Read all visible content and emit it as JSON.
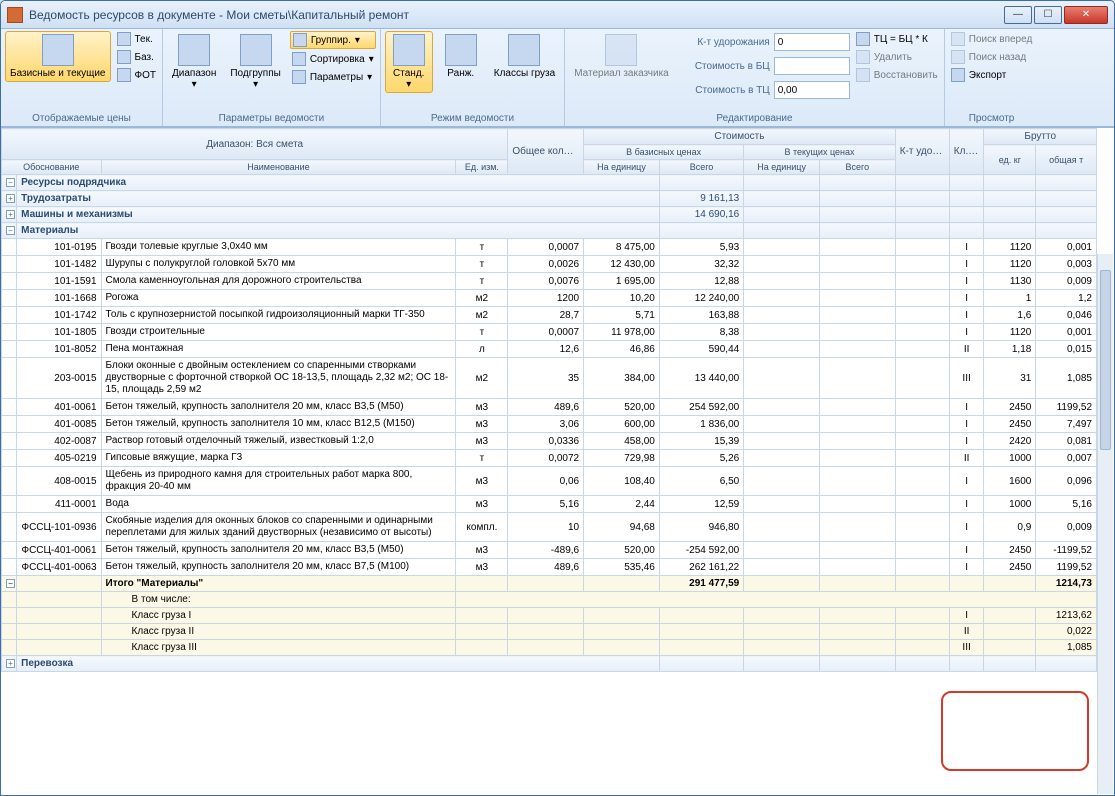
{
  "window": {
    "title": "Ведомость ресурсов в документе - Мои сметы\\Капитальный ремонт"
  },
  "ribbon": {
    "g1": {
      "big": "Базисные и текущие",
      "items": [
        "Тек.",
        "Баз.",
        "ФОТ"
      ],
      "label": "Отображаемые цены"
    },
    "g2": {
      "b1": "Диапазон",
      "b2": "Подгруппы",
      "items": [
        "Группир.",
        "Сортировка",
        "Параметры"
      ],
      "label": "Параметры ведомости"
    },
    "g3": {
      "b1": "Станд.",
      "b2": "Ранж.",
      "b3": "Классы груза",
      "label": "Режим ведомости"
    },
    "g4": {
      "b1": "Материал заказчика",
      "rows": [
        {
          "lbl": "К-т удорожания",
          "val": "0"
        },
        {
          "lbl": "Стоимость в БЦ",
          "val": ""
        },
        {
          "lbl": "Стоимость в ТЦ",
          "val": "0,00"
        }
      ],
      "items": [
        "ТЦ = БЦ * К",
        "Удалить",
        "Восстановить"
      ],
      "label": "Редактирование"
    },
    "g5": {
      "items": [
        "Поиск вперед",
        "Поиск назад",
        "Экспорт"
      ],
      "label": "Просмотр"
    }
  },
  "headers": {
    "range": "Диапазон: Вся смета",
    "cols": {
      "obos": "Обоснование",
      "name": "Наименование",
      "ed": "Ед. изм.",
      "qty": "Общее количество",
      "cost": "Стоимость",
      "base": "В базисных ценах",
      "cur": "В текущих ценах",
      "perunit": "На единицу",
      "total": "Всего",
      "kudor": "К-т удор. ТЦ=БЦ*К",
      "klgr": "Кл. гру-за",
      "brutto": "Брутто",
      "edkg": "ед. кг",
      "obt": "общая т"
    }
  },
  "groups": [
    {
      "exp": "−",
      "name": "Ресурсы подрядчика"
    },
    {
      "exp": "+",
      "name": "Трудозатраты",
      "total": "9 161,13"
    },
    {
      "exp": "+",
      "name": "Машины и механизмы",
      "total": "14 690,16"
    },
    {
      "exp": "−",
      "name": "Материалы"
    }
  ],
  "rows": [
    {
      "code": "101-0195",
      "name": "Гвозди толевые круглые 3,0х40 мм",
      "ed": "т",
      "qty": "0,0007",
      "pu": "8 475,00",
      "sum": "5,93",
      "kl": "I",
      "kg": "1120",
      "t": "0,001"
    },
    {
      "code": "101-1482",
      "name": "Шурупы с полукруглой головкой 5х70 мм",
      "ed": "т",
      "qty": "0,0026",
      "pu": "12 430,00",
      "sum": "32,32",
      "kl": "I",
      "kg": "1120",
      "t": "0,003"
    },
    {
      "code": "101-1591",
      "name": "Смола каменноугольная для дорожного строительства",
      "ed": "т",
      "qty": "0,0076",
      "pu": "1 695,00",
      "sum": "12,88",
      "kl": "I",
      "kg": "1130",
      "t": "0,009"
    },
    {
      "code": "101-1668",
      "name": "Рогожа",
      "ed": "м2",
      "qty": "1200",
      "pu": "10,20",
      "sum": "12 240,00",
      "kl": "I",
      "kg": "1",
      "t": "1,2"
    },
    {
      "code": "101-1742",
      "name": "Толь с крупнозернистой посыпкой гидроизоляционный марки ТГ-350",
      "ed": "м2",
      "qty": "28,7",
      "pu": "5,71",
      "sum": "163,88",
      "kl": "I",
      "kg": "1,6",
      "t": "0,046"
    },
    {
      "code": "101-1805",
      "name": "Гвозди строительные",
      "ed": "т",
      "qty": "0,0007",
      "pu": "11 978,00",
      "sum": "8,38",
      "kl": "I",
      "kg": "1120",
      "t": "0,001"
    },
    {
      "code": "101-8052",
      "name": "Пена монтажная",
      "ed": "л",
      "qty": "12,6",
      "pu": "46,86",
      "sum": "590,44",
      "kl": "II",
      "kg": "1,18",
      "t": "0,015"
    },
    {
      "code": "203-0015",
      "name": "Блоки оконные с двойным остеклением со спаренными створками двустворные с форточной створкой ОС 18-13,5, площадь 2,32 м2; ОС 18-15, площадь 2,59 м2",
      "ed": "м2",
      "qty": "35",
      "pu": "384,00",
      "sum": "13 440,00",
      "kl": "III",
      "kg": "31",
      "t": "1,085"
    },
    {
      "code": "401-0061",
      "name": "Бетон тяжелый, крупность заполнителя 20 мм, класс В3,5 (М50)",
      "ed": "м3",
      "qty": "489,6",
      "pu": "520,00",
      "sum": "254 592,00",
      "kl": "I",
      "kg": "2450",
      "t": "1199,52"
    },
    {
      "code": "401-0085",
      "name": "Бетон тяжелый, крупность заполнителя 10 мм, класс В12,5 (М150)",
      "ed": "м3",
      "qty": "3,06",
      "pu": "600,00",
      "sum": "1 836,00",
      "kl": "I",
      "kg": "2450",
      "t": "7,497"
    },
    {
      "code": "402-0087",
      "name": "Раствор готовый отделочный тяжелый, известковый 1:2,0",
      "ed": "м3",
      "qty": "0,0336",
      "pu": "458,00",
      "sum": "15,39",
      "kl": "I",
      "kg": "2420",
      "t": "0,081"
    },
    {
      "code": "405-0219",
      "name": "Гипсовые вяжущие, марка Г3",
      "ed": "т",
      "qty": "0,0072",
      "pu": "729,98",
      "sum": "5,26",
      "kl": "II",
      "kg": "1000",
      "t": "0,007"
    },
    {
      "code": "408-0015",
      "name": "Щебень из природного камня для строительных работ марка 800, фракция 20-40 мм",
      "ed": "м3",
      "qty": "0,06",
      "pu": "108,40",
      "sum": "6,50",
      "kl": "I",
      "kg": "1600",
      "t": "0,096"
    },
    {
      "code": "411-0001",
      "name": "Вода",
      "ed": "м3",
      "qty": "5,16",
      "pu": "2,44",
      "sum": "12,59",
      "kl": "I",
      "kg": "1000",
      "t": "5,16"
    },
    {
      "code": "ФСCЦ-101-0936",
      "name": "Скобяные изделия для оконных блоков со спаренными и одинарными переплетами для жилых зданий двустворных (независимо от высоты)",
      "ed": "компл.",
      "qty": "10",
      "pu": "94,68",
      "sum": "946,80",
      "kl": "I",
      "kg": "0,9",
      "t": "0,009"
    },
    {
      "code": "ФСCЦ-401-0061",
      "name": "Бетон тяжелый, крупность заполнителя 20 мм, класс В3,5 (М50)",
      "ed": "м3",
      "qty": "-489,6",
      "pu": "520,00",
      "sum": "-254 592,00",
      "kl": "I",
      "kg": "2450",
      "t": "-1199,52"
    },
    {
      "code": "ФСCЦ-401-0063",
      "name": "Бетон тяжелый, крупность заполнителя 20 мм, класс В7,5 (М100)",
      "ed": "м3",
      "qty": "489,6",
      "pu": "535,46",
      "sum": "262 161,22",
      "kl": "I",
      "kg": "2450",
      "t": "1199,52"
    }
  ],
  "totals": {
    "title": "Итого \"Материалы\"",
    "sum": "291 477,59",
    "t": "1214,73",
    "sublabel": "В том числе:",
    "subs": [
      {
        "name": "Класс груза I",
        "kl": "I",
        "t": "1213,62"
      },
      {
        "name": "Класс груза II",
        "kl": "II",
        "t": "0,022"
      },
      {
        "name": "Класс груза III",
        "kl": "III",
        "t": "1,085"
      }
    ]
  },
  "lastgroup": {
    "exp": "+",
    "name": "Перевозка"
  }
}
